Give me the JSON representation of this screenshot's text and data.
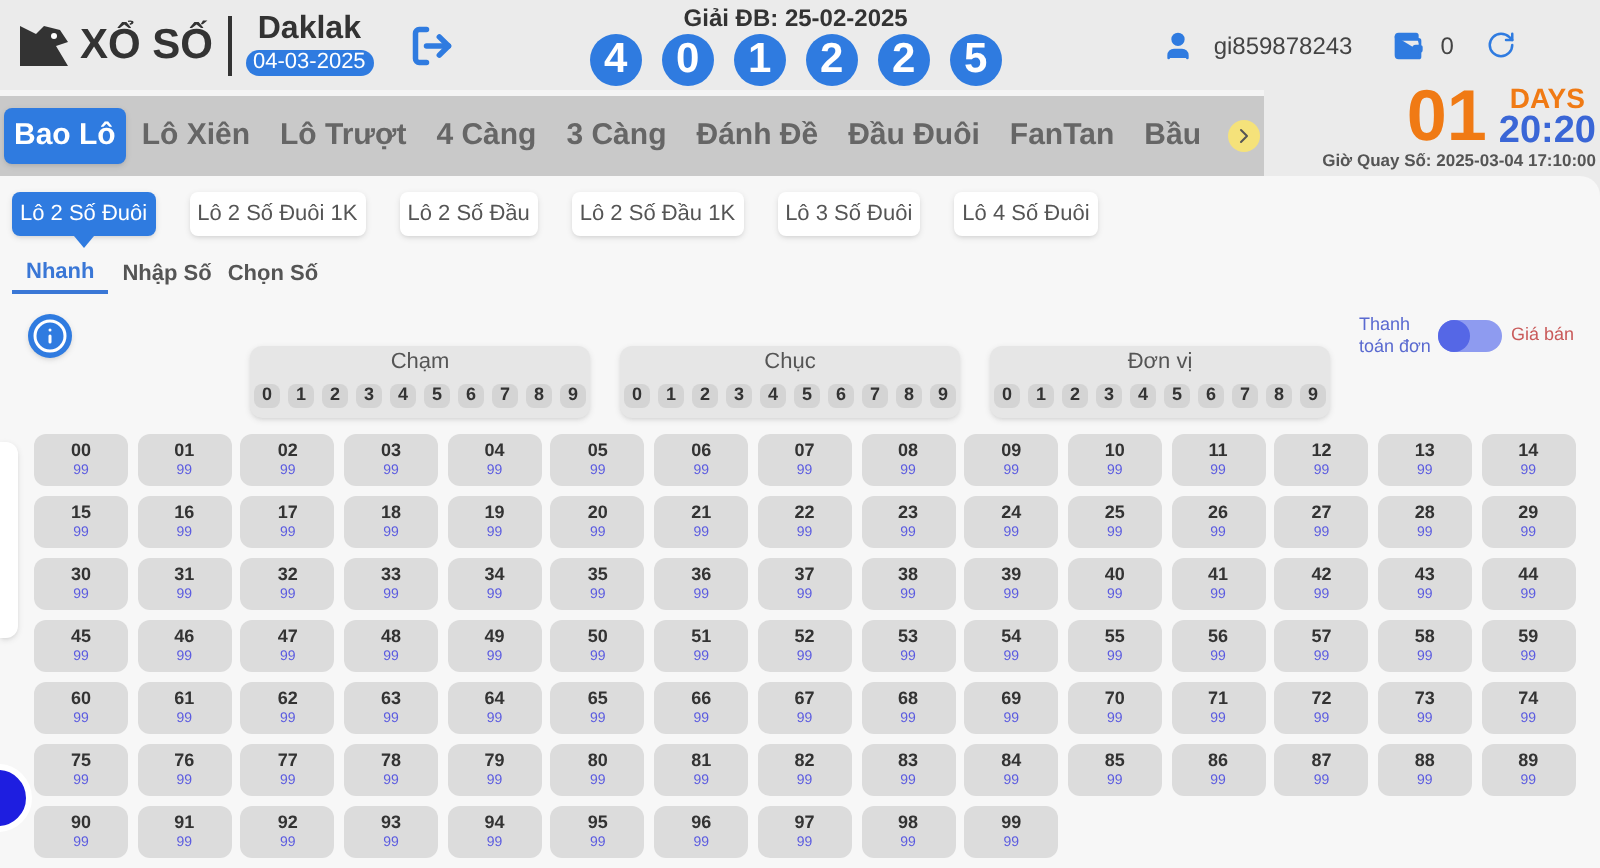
{
  "header": {
    "logo_text": "XỔ SỐ",
    "province": "Daklak",
    "date": "04-03-2025",
    "special_prize_label": "Giải ĐB: 25-02-2025",
    "special_prize_digits": [
      "4",
      "0",
      "1",
      "2",
      "2",
      "5"
    ],
    "username": "gi859878243",
    "balance": "0"
  },
  "game_tabs": [
    {
      "label": "Bao Lô",
      "selected": true
    },
    {
      "label": "Lô Xiên",
      "selected": false
    },
    {
      "label": "Lô Trượt",
      "selected": false
    },
    {
      "label": "4 Càng",
      "selected": false
    },
    {
      "label": "3 Càng",
      "selected": false
    },
    {
      "label": "Đánh Đề",
      "selected": false
    },
    {
      "label": "Đầu Đuôi",
      "selected": false
    },
    {
      "label": "FanTan",
      "selected": false
    },
    {
      "label": "Bầu",
      "selected": false
    }
  ],
  "countdown": {
    "days": "01",
    "days_label": "DAYS",
    "time": "20:20",
    "draw_time": "Giờ Quay Số: 2025-03-04 17:10:00"
  },
  "bet_types": [
    {
      "label": "Lô 2 Số Đuôi",
      "selected": true
    },
    {
      "label": "Lô 2 Số Đuôi 1K",
      "selected": false
    },
    {
      "label": "Lô 2 Số Đầu",
      "selected": false
    },
    {
      "label": "Lô 2 Số Đầu 1K",
      "selected": false
    },
    {
      "label": "Lô 3 Số Đuôi",
      "selected": false
    },
    {
      "label": "Lô 4 Số Đuôi",
      "selected": false
    }
  ],
  "input_modes": [
    {
      "label": "Nhanh",
      "selected": true
    },
    {
      "label": "Nhập Số",
      "selected": false
    },
    {
      "label": "Chọn Số",
      "selected": false
    }
  ],
  "payment_toggle": {
    "left_label": "Thanh toán đơn",
    "right_label": "Giá bán",
    "on": false
  },
  "digit_groups": [
    {
      "title": "Chạm",
      "digits": [
        "0",
        "1",
        "2",
        "3",
        "4",
        "5",
        "6",
        "7",
        "8",
        "9"
      ]
    },
    {
      "title": "Chục",
      "digits": [
        "0",
        "1",
        "2",
        "3",
        "4",
        "5",
        "6",
        "7",
        "8",
        "9"
      ]
    },
    {
      "title": "Đơn vị",
      "digits": [
        "0",
        "1",
        "2",
        "3",
        "4",
        "5",
        "6",
        "7",
        "8",
        "9"
      ]
    }
  ],
  "numbers": [
    {
      "number": "00",
      "price": "99"
    },
    {
      "number": "01",
      "price": "99"
    },
    {
      "number": "02",
      "price": "99"
    },
    {
      "number": "03",
      "price": "99"
    },
    {
      "number": "04",
      "price": "99"
    },
    {
      "number": "05",
      "price": "99"
    },
    {
      "number": "06",
      "price": "99"
    },
    {
      "number": "07",
      "price": "99"
    },
    {
      "number": "08",
      "price": "99"
    },
    {
      "number": "09",
      "price": "99"
    },
    {
      "number": "10",
      "price": "99"
    },
    {
      "number": "11",
      "price": "99"
    },
    {
      "number": "12",
      "price": "99"
    },
    {
      "number": "13",
      "price": "99"
    },
    {
      "number": "14",
      "price": "99"
    },
    {
      "number": "15",
      "price": "99"
    },
    {
      "number": "16",
      "price": "99"
    },
    {
      "number": "17",
      "price": "99"
    },
    {
      "number": "18",
      "price": "99"
    },
    {
      "number": "19",
      "price": "99"
    },
    {
      "number": "20",
      "price": "99"
    },
    {
      "number": "21",
      "price": "99"
    },
    {
      "number": "22",
      "price": "99"
    },
    {
      "number": "23",
      "price": "99"
    },
    {
      "number": "24",
      "price": "99"
    },
    {
      "number": "25",
      "price": "99"
    },
    {
      "number": "26",
      "price": "99"
    },
    {
      "number": "27",
      "price": "99"
    },
    {
      "number": "28",
      "price": "99"
    },
    {
      "number": "29",
      "price": "99"
    },
    {
      "number": "30",
      "price": "99"
    },
    {
      "number": "31",
      "price": "99"
    },
    {
      "number": "32",
      "price": "99"
    },
    {
      "number": "33",
      "price": "99"
    },
    {
      "number": "34",
      "price": "99"
    },
    {
      "number": "35",
      "price": "99"
    },
    {
      "number": "36",
      "price": "99"
    },
    {
      "number": "37",
      "price": "99"
    },
    {
      "number": "38",
      "price": "99"
    },
    {
      "number": "39",
      "price": "99"
    },
    {
      "number": "40",
      "price": "99"
    },
    {
      "number": "41",
      "price": "99"
    },
    {
      "number": "42",
      "price": "99"
    },
    {
      "number": "43",
      "price": "99"
    },
    {
      "number": "44",
      "price": "99"
    },
    {
      "number": "45",
      "price": "99"
    },
    {
      "number": "46",
      "price": "99"
    },
    {
      "number": "47",
      "price": "99"
    },
    {
      "number": "48",
      "price": "99"
    },
    {
      "number": "49",
      "price": "99"
    },
    {
      "number": "50",
      "price": "99"
    },
    {
      "number": "51",
      "price": "99"
    },
    {
      "number": "52",
      "price": "99"
    },
    {
      "number": "53",
      "price": "99"
    },
    {
      "number": "54",
      "price": "99"
    },
    {
      "number": "55",
      "price": "99"
    },
    {
      "number": "56",
      "price": "99"
    },
    {
      "number": "57",
      "price": "99"
    },
    {
      "number": "58",
      "price": "99"
    },
    {
      "number": "59",
      "price": "99"
    },
    {
      "number": "60",
      "price": "99"
    },
    {
      "number": "61",
      "price": "99"
    },
    {
      "number": "62",
      "price": "99"
    },
    {
      "number": "63",
      "price": "99"
    },
    {
      "number": "64",
      "price": "99"
    },
    {
      "number": "65",
      "price": "99"
    },
    {
      "number": "66",
      "price": "99"
    },
    {
      "number": "67",
      "price": "99"
    },
    {
      "number": "68",
      "price": "99"
    },
    {
      "number": "69",
      "price": "99"
    },
    {
      "number": "70",
      "price": "99"
    },
    {
      "number": "71",
      "price": "99"
    },
    {
      "number": "72",
      "price": "99"
    },
    {
      "number": "73",
      "price": "99"
    },
    {
      "number": "74",
      "price": "99"
    },
    {
      "number": "75",
      "price": "99"
    },
    {
      "number": "76",
      "price": "99"
    },
    {
      "number": "77",
      "price": "99"
    },
    {
      "number": "78",
      "price": "99"
    },
    {
      "number": "79",
      "price": "99"
    },
    {
      "number": "80",
      "price": "99"
    },
    {
      "number": "81",
      "price": "99"
    },
    {
      "number": "82",
      "price": "99"
    },
    {
      "number": "83",
      "price": "99"
    },
    {
      "number": "84",
      "price": "99"
    },
    {
      "number": "85",
      "price": "99"
    },
    {
      "number": "86",
      "price": "99"
    },
    {
      "number": "87",
      "price": "99"
    },
    {
      "number": "88",
      "price": "99"
    },
    {
      "number": "89",
      "price": "99"
    },
    {
      "number": "90",
      "price": "99"
    },
    {
      "number": "91",
      "price": "99"
    },
    {
      "number": "92",
      "price": "99"
    },
    {
      "number": "93",
      "price": "99"
    },
    {
      "number": "94",
      "price": "99"
    },
    {
      "number": "95",
      "price": "99"
    },
    {
      "number": "96",
      "price": "99"
    },
    {
      "number": "97",
      "price": "99"
    },
    {
      "number": "98",
      "price": "99"
    },
    {
      "number": "99",
      "price": "99"
    }
  ]
}
